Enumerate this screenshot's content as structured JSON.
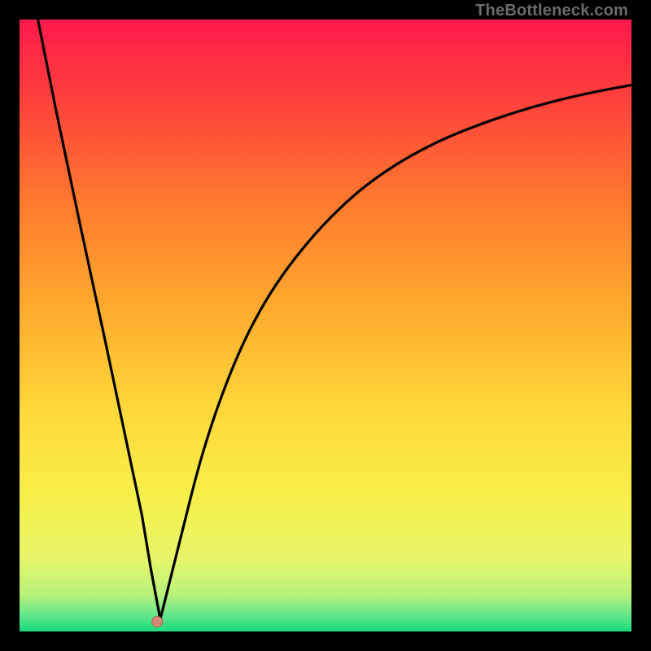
{
  "watermark": "TheBottleneck.com",
  "colors": {
    "black": "#000000",
    "curve": "#000000",
    "marker_fill": "#d58a74",
    "marker_stroke": "#b06a55",
    "gradient_stops": [
      {
        "offset": 0.0,
        "color": "#ff1a4b"
      },
      {
        "offset": 0.12,
        "color": "#ff3d3d"
      },
      {
        "offset": 0.3,
        "color": "#ff7a2e"
      },
      {
        "offset": 0.48,
        "color": "#ffad2e"
      },
      {
        "offset": 0.64,
        "color": "#ffd93a"
      },
      {
        "offset": 0.78,
        "color": "#f7ef4a"
      },
      {
        "offset": 0.88,
        "color": "#e8f56a"
      },
      {
        "offset": 0.94,
        "color": "#b8f27a"
      },
      {
        "offset": 0.975,
        "color": "#5fe68a"
      },
      {
        "offset": 1.0,
        "color": "#17d97c"
      }
    ]
  },
  "chart_data": {
    "type": "line",
    "title": "",
    "xlabel": "",
    "ylabel": "",
    "xlim": [
      0,
      100
    ],
    "ylim": [
      0,
      100
    ],
    "notes": "V-shaped bottleneck curve. Left branch is nearly straight from top-left border down to the minimum; right branch rises with a decelerating (saturating) curve toward the upper-right. Minimum (optimum) marked with a small dot near the bottom.",
    "series": [
      {
        "name": "bottleneck-curve",
        "x": [
          3,
          6,
          10,
          14,
          18,
          20,
          21.5,
          23,
          26,
          30,
          35,
          40,
          46,
          53,
          60,
          68,
          76,
          84,
          92,
          100
        ],
        "y": [
          100,
          85,
          66,
          47.5,
          28.5,
          19,
          10,
          2,
          14,
          30,
          44,
          54,
          62.5,
          70,
          75.5,
          80,
          83.2,
          85.8,
          87.8,
          89.3
        ]
      }
    ],
    "marker": {
      "x": 22.5,
      "y": 1.6
    }
  }
}
